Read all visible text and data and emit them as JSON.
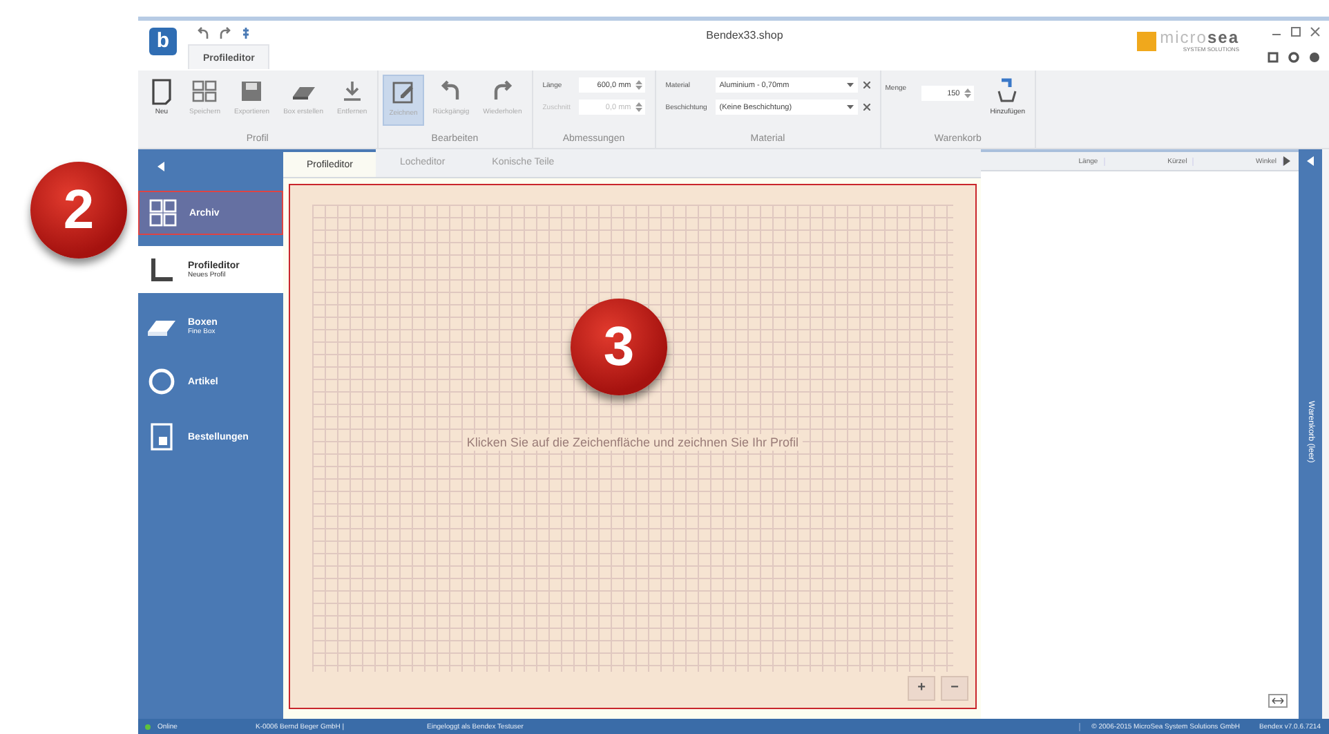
{
  "window": {
    "logo": "b",
    "title": "Bendex33.shop",
    "tab": "Profileditor"
  },
  "brand": {
    "part1": "micro",
    "part2": "sea",
    "tagline": "SYSTEM SOLUTIONS"
  },
  "ribbon": {
    "groups": [
      {
        "label": "Profil",
        "buttons": [
          {
            "label": "Neu",
            "selected": false,
            "disabled": false
          },
          {
            "label": "Speichern",
            "selected": false,
            "disabled": true
          },
          {
            "label": "Exportieren",
            "selected": false,
            "disabled": true
          },
          {
            "label": "Box erstellen",
            "selected": false,
            "disabled": true
          },
          {
            "label": "Entfernen",
            "selected": false,
            "disabled": true
          }
        ]
      },
      {
        "label": "Bearbeiten",
        "buttons": [
          {
            "label": "Zeichnen",
            "selected": true,
            "disabled": true
          },
          {
            "label": "Rückgängig",
            "selected": false,
            "disabled": true
          },
          {
            "label": "Wiederholen",
            "selected": false,
            "disabled": true
          }
        ]
      },
      {
        "label": "Abmessungen",
        "fields": [
          {
            "label": "Länge",
            "value": "600,0 mm",
            "disabled": false
          },
          {
            "label": "Zuschnitt",
            "value": "0,0 mm",
            "disabled": true
          }
        ]
      },
      {
        "label": "Material",
        "selects": [
          {
            "label": "Material",
            "value": "Aluminium - 0,70mm"
          },
          {
            "label": "Beschichtung",
            "value": "(Keine Beschichtung)"
          }
        ]
      },
      {
        "label": "Warenkorb",
        "quantity": {
          "label": "Menge",
          "value": "150"
        },
        "action": "Hinzufügen"
      }
    ]
  },
  "sidebar": {
    "items": [
      {
        "label": "Archiv",
        "selected": false,
        "highlighted": true
      },
      {
        "label": "Profileditor",
        "sublabel": "Neues Profil",
        "selected": true,
        "highlighted": false
      },
      {
        "label": "Boxen",
        "sublabel": "Fine Box",
        "selected": false,
        "highlighted": false
      },
      {
        "label": "Artikel",
        "selected": false,
        "highlighted": false
      },
      {
        "label": "Bestellungen",
        "selected": false,
        "highlighted": false
      }
    ]
  },
  "tabs": [
    {
      "label": "Profileditor",
      "selected": true
    },
    {
      "label": "Locheditor",
      "selected": false
    },
    {
      "label": "Konische Teile",
      "selected": false
    }
  ],
  "canvas": {
    "hint": "Klicken Sie auf die Zeichenfläche und zeichnen Sie Ihr Profil",
    "highlighted": true,
    "zoom_buttons": [
      "+",
      "−"
    ]
  },
  "table": {
    "columns": [
      "Länge",
      "Kürzel",
      "Winkel"
    ]
  },
  "cart_panel": {
    "label": "Warenkorb (leer)"
  },
  "status_bar": {
    "online": "Online",
    "customer": "K-0006 Bernd Beger GmbH |",
    "login": "Eingeloggt als Bendex Testuser",
    "copyright": "© 2006-2015 MicroSea System Solutions GmbH",
    "version": "Bendex v7.0.6.7214"
  },
  "annotations": [
    {
      "label": "2"
    },
    {
      "label": "3"
    }
  ]
}
